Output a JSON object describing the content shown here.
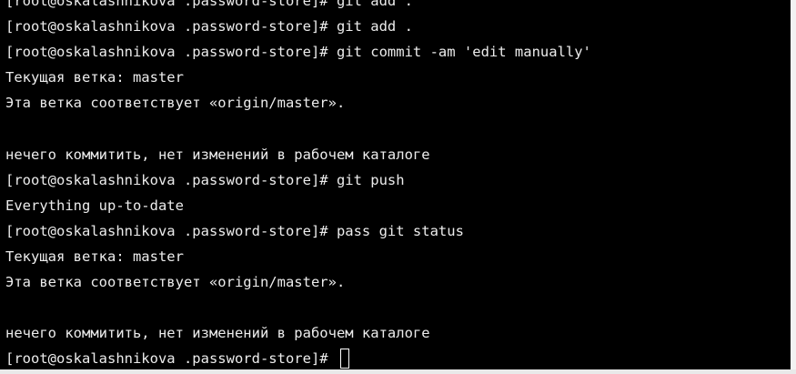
{
  "terminal": {
    "lines": [
      "[root@oskalashnikova .password-store]# git add .",
      "[root@oskalashnikova .password-store]# git add .",
      "[root@oskalashnikova .password-store]# git commit -am 'edit manually'",
      "Текущая ветка: master",
      "Эта ветка соответствует «origin/master».",
      "",
      "нечего коммитить, нет изменений в рабочем каталоге",
      "[root@oskalashnikova .password-store]# git push",
      "Everything up-to-date",
      "[root@oskalashnikova .password-store]# pass git status",
      "Текущая ветка: master",
      "Эта ветка соответствует «origin/master».",
      "",
      "нечего коммитить, нет изменений в рабочем каталоге"
    ],
    "prompt": "[root@oskalashnikova .password-store]# "
  },
  "colors": {
    "background": "#000000",
    "foreground": "#ececec",
    "frame": "#e9e9e9"
  }
}
